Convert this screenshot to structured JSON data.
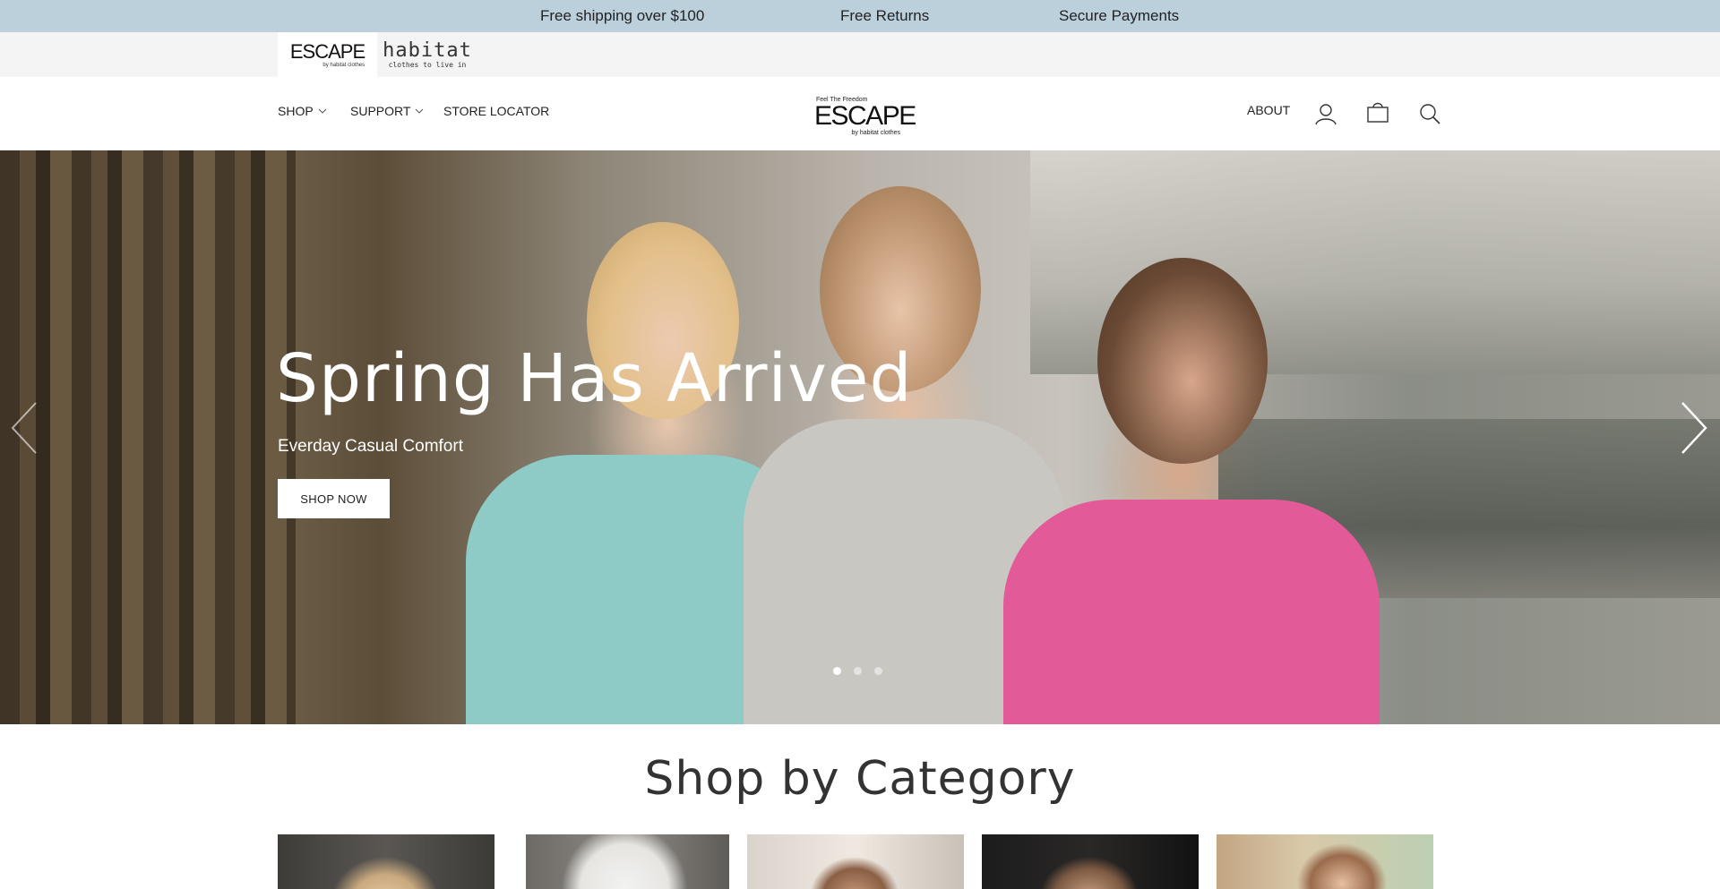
{
  "announcement": {
    "items": [
      "Free shipping over $100",
      "Free Returns",
      "Secure Payments"
    ]
  },
  "brand_switcher": {
    "escape": {
      "main": "ESCAPE",
      "sub": "by habitat clothes"
    },
    "habitat": {
      "main": "habitat",
      "sub": "clothes to live in"
    }
  },
  "header": {
    "nav": {
      "shop": "SHOP",
      "support": "SUPPORT",
      "store_locator": "STORE LOCATOR"
    },
    "logo": {
      "tagline": "Feel The Freedom",
      "main": "ESCAPE",
      "sub": "by habitat clothes"
    },
    "about": "ABOUT",
    "icons": [
      "user-icon",
      "bag-icon",
      "search-icon"
    ]
  },
  "hero": {
    "title": "Spring Has Arrived",
    "subtitle": "Everday Casual Comfort",
    "button": "SHOP NOW",
    "slides_total": 3,
    "active_slide": 1
  },
  "category": {
    "title": "Shop by Category"
  },
  "colors": {
    "announcement_bg": "#bcd0dc",
    "brandbar_bg": "#f4f4f4",
    "text": "#222222"
  }
}
